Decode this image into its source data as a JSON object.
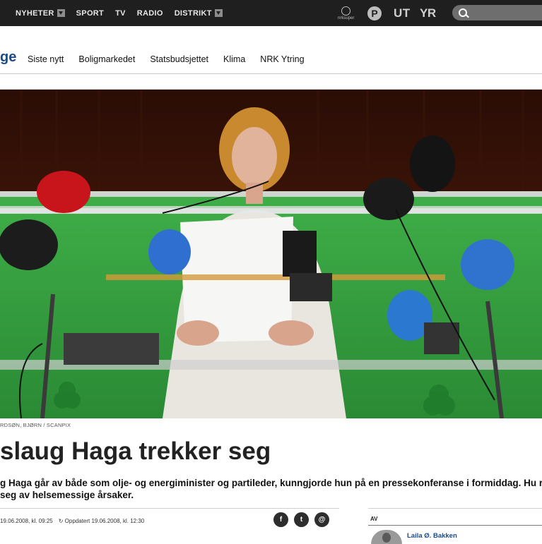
{
  "topnav": {
    "items": [
      {
        "label": "NYHETER",
        "has_dropdown": true
      },
      {
        "label": "SPORT",
        "has_dropdown": false
      },
      {
        "label": "TV",
        "has_dropdown": false
      },
      {
        "label": "RADIO",
        "has_dropdown": false
      },
      {
        "label": "DISTRIKT",
        "has_dropdown": true
      }
    ],
    "brands": {
      "super": "nrksuper",
      "p": "P",
      "ut": "UT",
      "yr": "YR"
    },
    "search_icon": "search-icon"
  },
  "section": {
    "label_fragment": "ge",
    "links": [
      "Siste nytt",
      "Boligmarkedet",
      "Statsbudsjettet",
      "Klima",
      "NRK Ytring"
    ]
  },
  "article": {
    "photo_credit": "RDSØN, BJØRN / SCANPIX",
    "headline": "slaug Haga trekker seg",
    "lead": "g Haga går av både som olje- og energiminister og partileder, kunngjorde hun på en pressekonferanse i formiddag. Hu r seg av helsemessige årsaker.",
    "published": "19.06.2008, kl. 09:25",
    "updated_label": "Oppdatert",
    "updated": "19.06.2008, kl. 12:30",
    "share": {
      "facebook": "f",
      "twitter": "t",
      "email": "@"
    }
  },
  "byline": {
    "heading": "AV",
    "author": "Laila Ø. Bakken"
  },
  "colors": {
    "topbar": "#1f1f1f",
    "link_blue": "#1a4a8c",
    "podium_green": "#2f9a3c"
  }
}
